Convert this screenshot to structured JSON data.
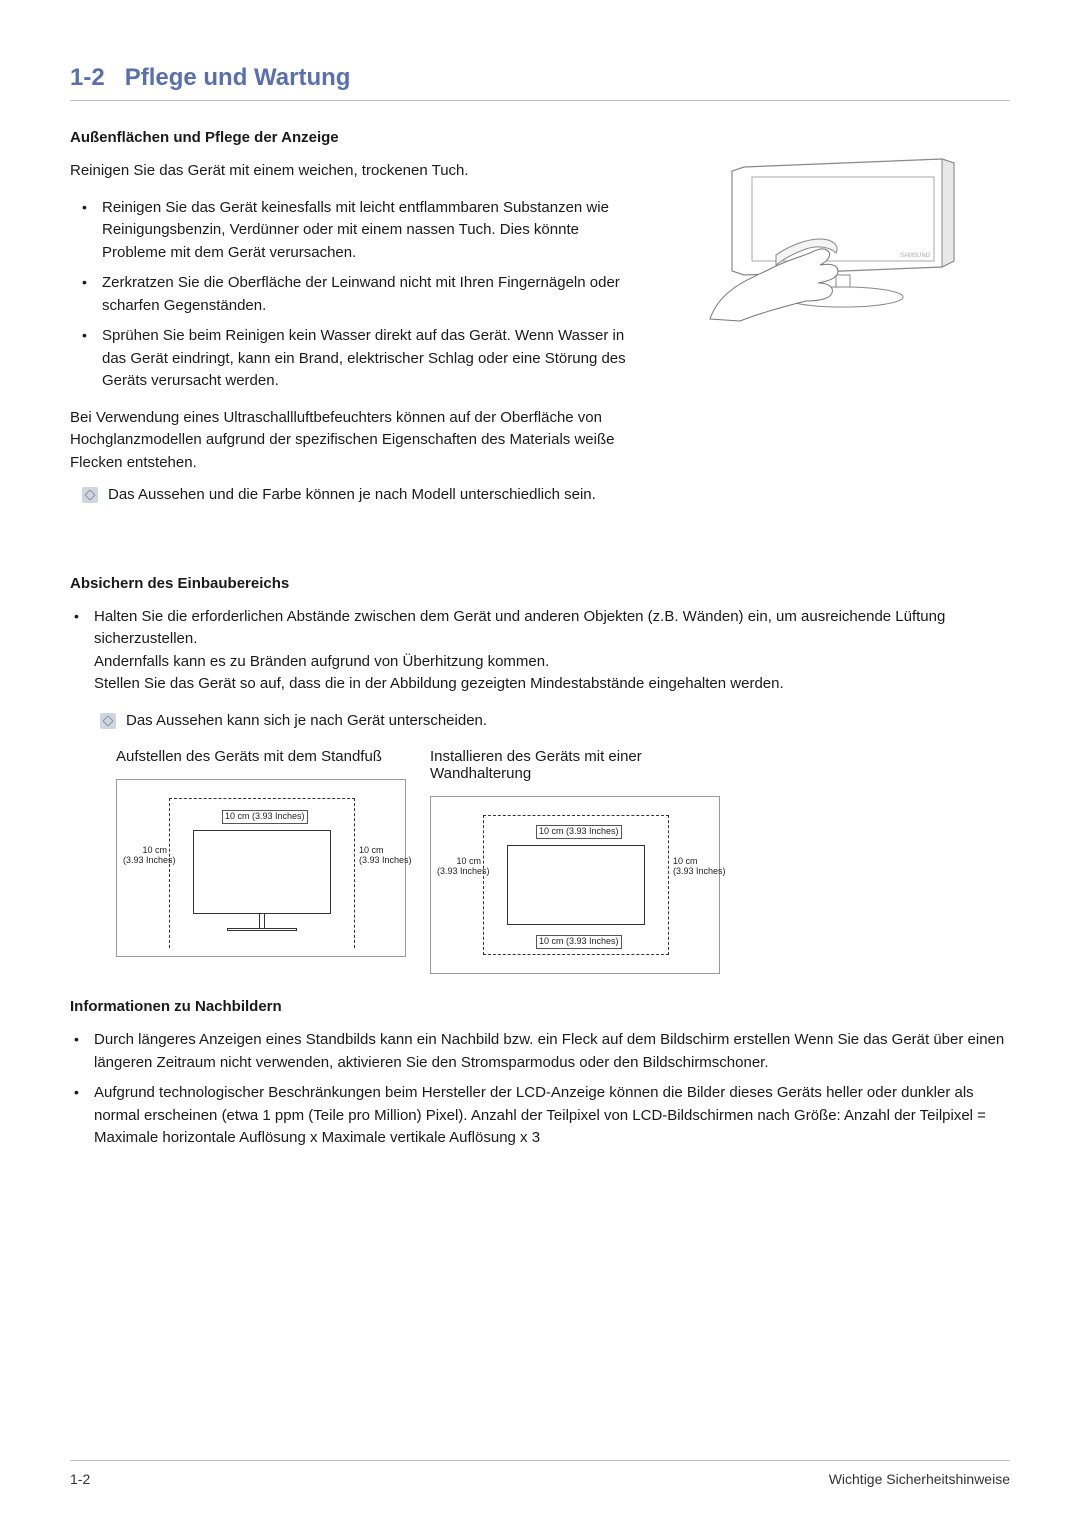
{
  "header": {
    "number": "1-2",
    "title": "Pflege und Wartung"
  },
  "section1": {
    "heading": "Außenflächen und Pflege der Anzeige",
    "intro": "Reinigen Sie das Gerät mit einem weichen, trockenen Tuch.",
    "bullets": [
      "Reinigen Sie das Gerät keinesfalls mit leicht entflammbaren Substanzen wie Reinigungsbenzin, Verdünner oder mit einem nassen Tuch. Dies könnte Probleme mit dem Gerät verursachen.",
      "Zerkratzen Sie die Oberfläche der Leinwand nicht mit Ihren Fingernägeln oder scharfen Gegenständen.",
      "Sprühen Sie beim Reinigen kein Wasser direkt auf das Gerät. Wenn Wasser in das Gerät eindringt, kann ein Brand, elektrischer Schlag oder eine Störung des Geräts verursacht werden."
    ],
    "after_bullets": "Bei Verwendung eines Ultraschallluftbefeuchters können auf der Oberfläche von Hochglanzmodellen aufgrund der spezifischen Eigenschaften des Materials weiße Flecken entstehen.",
    "note": "Das Aussehen und die Farbe können je nach Modell unterschiedlich sein."
  },
  "section2": {
    "heading": "Absichern des Einbaubereichs",
    "bullet_main": "Halten Sie die erforderlichen Abstände zwischen dem Gerät und anderen Objekten (z.B. Wänden) ein, um ausreichende Lüftung sicherzustellen.",
    "bullet_line2": "Andernfalls kann es zu Bränden aufgrund von Überhitzung kommen.",
    "bullet_line3": "Stellen Sie das Gerät so auf, dass die in der Abbildung gezeigten Mindestabstände eingehalten werden.",
    "note": "Das Aussehen kann sich je nach Gerät unterscheiden.",
    "diagram_left_caption": "Aufstellen des Geräts mit dem Standfuß",
    "diagram_right_caption": "Installieren des Geräts mit einer Wandhalterung",
    "dim_top": "10 cm (3.93 Inches)",
    "dim_side_line1": "10 cm",
    "dim_side_line2": "(3.93 Inches)",
    "dim_bottom": "10 cm (3.93 Inches)"
  },
  "section3": {
    "heading": "Informationen zu Nachbildern",
    "bullets": [
      "Durch längeres Anzeigen eines Standbilds kann ein Nachbild bzw. ein Fleck auf dem Bildschirm erstellen Wenn Sie das Gerät über einen längeren Zeitraum nicht verwenden, aktivieren Sie den Stromsparmodus oder den Bildschirmschoner.",
      "Aufgrund technologischer Beschränkungen beim Hersteller der LCD-Anzeige können die Bilder dieses Geräts heller oder dunkler als normal erscheinen (etwa 1 ppm (Teile pro Million) Pixel). Anzahl der Teilpixel von LCD-Bildschirmen nach Größe: Anzahl der Teilpixel = Maximale horizontale Auflösung x Maximale vertikale Auflösung x 3"
    ]
  },
  "footer": {
    "left": "1-2",
    "right": "Wichtige Sicherheitshinweise"
  }
}
